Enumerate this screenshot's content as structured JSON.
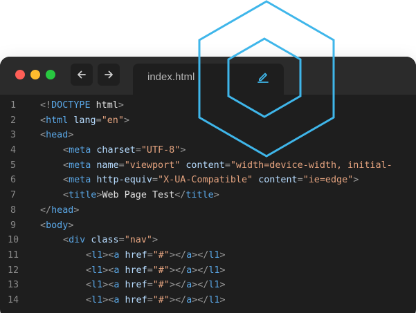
{
  "window": {
    "traffic_lights": [
      {
        "name": "close",
        "color": "#ff5f57"
      },
      {
        "name": "minimize",
        "color": "#febc2e"
      },
      {
        "name": "maximize",
        "color": "#28c840"
      }
    ],
    "nav": {
      "back_icon": "arrow-left-icon",
      "forward_icon": "arrow-right-icon"
    },
    "tab": {
      "label": "index.html",
      "edit_icon": "pencil-icon"
    }
  },
  "accent_color": "#3fb6ea",
  "syntax_colors": {
    "tag": "#5aa7e6",
    "attribute": "#b7dcff",
    "string": "#e4a37f",
    "punctuation": "#9a9a9a",
    "text": "#e0e0e0",
    "line_number": "#8a8a8a"
  },
  "code": {
    "lines": [
      {
        "n": "1",
        "indent": 0,
        "tokens": [
          [
            "p",
            "<!"
          ],
          [
            "t",
            "DOCTYPE"
          ],
          [
            "x",
            " html"
          ],
          [
            "p",
            ">"
          ]
        ]
      },
      {
        "n": "2",
        "indent": 0,
        "tokens": [
          [
            "p",
            "<"
          ],
          [
            "t",
            "html"
          ],
          [
            "x",
            " "
          ],
          [
            "a",
            "lang"
          ],
          [
            "p",
            "="
          ],
          [
            "s",
            "\"en\""
          ],
          [
            "p",
            ">"
          ]
        ]
      },
      {
        "n": "3",
        "indent": 0,
        "tokens": [
          [
            "p",
            "<"
          ],
          [
            "t",
            "head"
          ],
          [
            "p",
            ">"
          ]
        ]
      },
      {
        "n": "4",
        "indent": 1,
        "tokens": [
          [
            "p",
            "<"
          ],
          [
            "t",
            "meta"
          ],
          [
            "x",
            " "
          ],
          [
            "a",
            "charset"
          ],
          [
            "p",
            "="
          ],
          [
            "s",
            "\"UTF-8\""
          ],
          [
            "p",
            ">"
          ]
        ]
      },
      {
        "n": "5",
        "indent": 1,
        "tokens": [
          [
            "p",
            "<"
          ],
          [
            "t",
            "meta"
          ],
          [
            "x",
            " "
          ],
          [
            "a",
            "name"
          ],
          [
            "p",
            "="
          ],
          [
            "s",
            "\"viewport\""
          ],
          [
            "x",
            " "
          ],
          [
            "a",
            "content"
          ],
          [
            "p",
            "="
          ],
          [
            "s",
            "\"width=device-width, initial-"
          ]
        ]
      },
      {
        "n": "6",
        "indent": 1,
        "tokens": [
          [
            "p",
            "<"
          ],
          [
            "t",
            "meta"
          ],
          [
            "x",
            " "
          ],
          [
            "a",
            "http-equiv"
          ],
          [
            "p",
            "="
          ],
          [
            "s",
            "\"X-UA-Compatible\""
          ],
          [
            "x",
            " "
          ],
          [
            "a",
            "content"
          ],
          [
            "p",
            "="
          ],
          [
            "s",
            "\"ie=edge\""
          ],
          [
            "p",
            ">"
          ]
        ]
      },
      {
        "n": "7",
        "indent": 1,
        "tokens": [
          [
            "p",
            "<"
          ],
          [
            "t",
            "title"
          ],
          [
            "p",
            ">"
          ],
          [
            "x",
            "Web Page Test"
          ],
          [
            "p",
            "</"
          ],
          [
            "t",
            "title"
          ],
          [
            "p",
            ">"
          ]
        ]
      },
      {
        "n": "8",
        "indent": 0,
        "tokens": [
          [
            "p",
            "</"
          ],
          [
            "t",
            "head"
          ],
          [
            "p",
            ">"
          ]
        ]
      },
      {
        "n": "9",
        "indent": 0,
        "tokens": [
          [
            "p",
            "<"
          ],
          [
            "t",
            "body"
          ],
          [
            "p",
            ">"
          ]
        ]
      },
      {
        "n": "10",
        "indent": 1,
        "tokens": [
          [
            "p",
            "<"
          ],
          [
            "t",
            "div"
          ],
          [
            "x",
            " "
          ],
          [
            "a",
            "class"
          ],
          [
            "p",
            "="
          ],
          [
            "s",
            "\"nav\""
          ],
          [
            "p",
            ">"
          ]
        ]
      },
      {
        "n": "11",
        "indent": 2,
        "tokens": [
          [
            "p",
            "<"
          ],
          [
            "t",
            "l1"
          ],
          [
            "p",
            "><"
          ],
          [
            "t",
            "a"
          ],
          [
            "x",
            " "
          ],
          [
            "a",
            "href"
          ],
          [
            "p",
            "="
          ],
          [
            "s",
            "\"#\""
          ],
          [
            "p",
            "></"
          ],
          [
            "t",
            "a"
          ],
          [
            "p",
            "></"
          ],
          [
            "t",
            "l1"
          ],
          [
            "p",
            ">"
          ]
        ]
      },
      {
        "n": "12",
        "indent": 2,
        "tokens": [
          [
            "p",
            "<"
          ],
          [
            "t",
            "l1"
          ],
          [
            "p",
            "><"
          ],
          [
            "t",
            "a"
          ],
          [
            "x",
            " "
          ],
          [
            "a",
            "href"
          ],
          [
            "p",
            "="
          ],
          [
            "s",
            "\"#\""
          ],
          [
            "p",
            "></"
          ],
          [
            "t",
            "a"
          ],
          [
            "p",
            "></"
          ],
          [
            "t",
            "l1"
          ],
          [
            "p",
            ">"
          ]
        ]
      },
      {
        "n": "13",
        "indent": 2,
        "tokens": [
          [
            "p",
            "<"
          ],
          [
            "t",
            "l1"
          ],
          [
            "p",
            "><"
          ],
          [
            "t",
            "a"
          ],
          [
            "x",
            " "
          ],
          [
            "a",
            "href"
          ],
          [
            "p",
            "="
          ],
          [
            "s",
            "\"#\""
          ],
          [
            "p",
            "></"
          ],
          [
            "t",
            "a"
          ],
          [
            "p",
            "></"
          ],
          [
            "t",
            "l1"
          ],
          [
            "p",
            ">"
          ]
        ]
      },
      {
        "n": "14",
        "indent": 2,
        "tokens": [
          [
            "p",
            "<"
          ],
          [
            "t",
            "l1"
          ],
          [
            "p",
            "><"
          ],
          [
            "t",
            "a"
          ],
          [
            "x",
            " "
          ],
          [
            "a",
            "href"
          ],
          [
            "p",
            "="
          ],
          [
            "s",
            "\"#\""
          ],
          [
            "p",
            "></"
          ],
          [
            "t",
            "a"
          ],
          [
            "p",
            "></"
          ],
          [
            "t",
            "l1"
          ],
          [
            "p",
            ">"
          ]
        ]
      }
    ]
  }
}
